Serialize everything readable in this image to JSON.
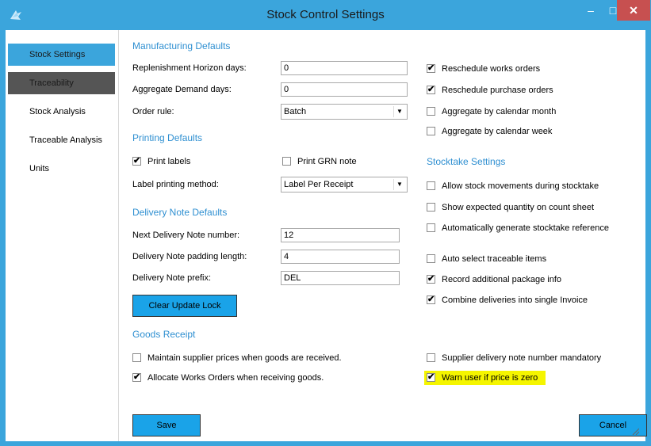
{
  "window": {
    "title": "Stock Control Settings",
    "min_icon": "minimize-icon",
    "max_icon": "maximize-icon",
    "close_icon": "close-icon",
    "close_glyph": "✕",
    "min_glyph": "–",
    "max_glyph": "□",
    "accent_color": "#3ba5dc",
    "close_color": "#c75050"
  },
  "sidebar": {
    "items": [
      {
        "label": "Stock Settings"
      },
      {
        "label": "Traceability"
      },
      {
        "label": "Stock Analysis"
      },
      {
        "label": "Traceable Analysis"
      },
      {
        "label": "Units"
      }
    ]
  },
  "manufacturing": {
    "heading": "Manufacturing Defaults",
    "horizon_label": "Replenishment Horizon days:",
    "horizon_value": "0",
    "aggregate_label": "Aggregate Demand days:",
    "aggregate_value": "0",
    "order_rule_label": "Order rule:",
    "order_rule_value": "Batch",
    "reschedule_works": "Reschedule works orders",
    "reschedule_works_checked": true,
    "reschedule_purchase": "Reschedule purchase orders",
    "reschedule_purchase_checked": true,
    "agg_month": "Aggregate by calendar month",
    "agg_month_checked": false,
    "agg_week": "Aggregate by calendar week",
    "agg_week_checked": false
  },
  "printing": {
    "heading": "Printing Defaults",
    "print_labels": "Print labels",
    "print_labels_checked": true,
    "print_grn": "Print GRN note",
    "print_grn_checked": false,
    "method_label": "Label printing method:",
    "method_value": "Label Per Receipt"
  },
  "delivery": {
    "heading": "Delivery Note Defaults",
    "next_label": "Next Delivery Note number:",
    "next_value": "12",
    "padding_label": "Delivery Note padding length:",
    "padding_value": "4",
    "prefix_label": "Delivery Note prefix:",
    "prefix_value": "DEL",
    "clear_button": "Clear Update Lock"
  },
  "stocktake": {
    "heading": "Stocktake Settings",
    "allow_movements": "Allow stock movements during stocktake",
    "allow_movements_checked": false,
    "show_expected": "Show expected quantity on count sheet",
    "show_expected_checked": false,
    "auto_reference": "Automatically generate stocktake reference",
    "auto_reference_checked": false,
    "auto_select": "Auto select traceable items",
    "auto_select_checked": false,
    "record_package": "Record additional package info",
    "record_package_checked": true,
    "combine": "Combine deliveries into single Invoice",
    "combine_checked": true
  },
  "goods": {
    "heading": "Goods Receipt",
    "maintain": "Maintain supplier prices when goods are received.",
    "maintain_checked": false,
    "allocate": "Allocate Works Orders when receiving goods.",
    "allocate_checked": true,
    "supplier_mandatory": "Supplier delivery note number mandatory",
    "supplier_mandatory_checked": false,
    "warn_zero": "Warn user if price is zero",
    "warn_zero_checked": true,
    "highlight_color": "#f5f500"
  },
  "footer": {
    "save": "Save",
    "cancel": "Cancel"
  },
  "check_glyph": "✔"
}
